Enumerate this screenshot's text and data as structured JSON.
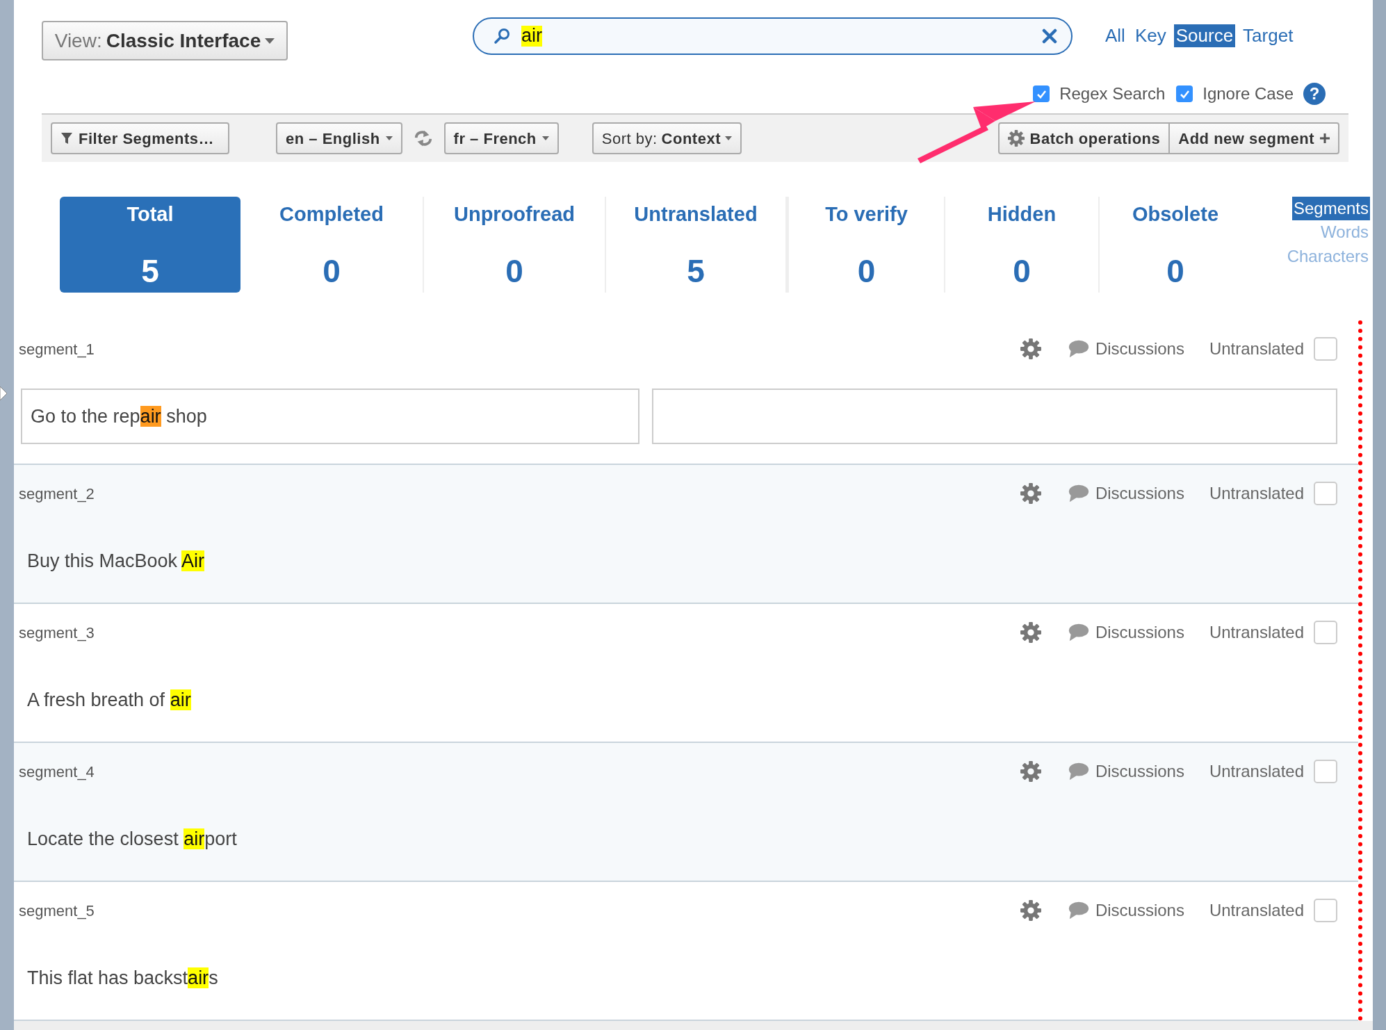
{
  "view_selector": {
    "label": "View:",
    "value": "Classic Interface"
  },
  "search": {
    "query": "air"
  },
  "search_scopes": [
    {
      "label": "All",
      "selected": false
    },
    {
      "label": "Key",
      "selected": false
    },
    {
      "label": "Source",
      "selected": true
    },
    {
      "label": "Target",
      "selected": false
    }
  ],
  "search_options": [
    {
      "label": "Regex Search",
      "checked": true
    },
    {
      "label": "Ignore Case",
      "checked": true
    }
  ],
  "help": {
    "label": "?"
  },
  "toolbar": {
    "filter": "Filter Segments…",
    "source_language": "en – English",
    "target_language": "fr – French",
    "sort_label": "Sort by:",
    "sort_value": "Context",
    "batch": "Batch operations",
    "add": "Add new segment"
  },
  "stats": [
    {
      "label": "Total",
      "value": "5",
      "selected": true
    },
    {
      "label": "Completed",
      "value": "0",
      "selected": false
    },
    {
      "label": "Unproofread",
      "value": "0",
      "selected": false
    },
    {
      "label": "Untranslated",
      "value": "5",
      "selected": false
    },
    {
      "label": "To verify",
      "value": "0",
      "selected": false
    },
    {
      "label": "Hidden",
      "value": "0",
      "selected": false
    },
    {
      "label": "Obsolete",
      "value": "0",
      "selected": false
    }
  ],
  "units": [
    {
      "label": "Segments",
      "selected": true
    },
    {
      "label": "Words",
      "selected": false
    },
    {
      "label": "Characters",
      "selected": false
    }
  ],
  "segments": [
    {
      "key": "segment_1",
      "discussions": "Discussions",
      "status": "Untranslated",
      "checked": false,
      "editing": true,
      "source": [
        {
          "text": "Go to the rep",
          "kind": "text"
        },
        {
          "text": "air",
          "kind": "current-match"
        },
        {
          "text": " shop",
          "kind": "text"
        }
      ]
    },
    {
      "key": "segment_2",
      "discussions": "Discussions",
      "status": "Untranslated",
      "checked": false,
      "editing": false,
      "source": [
        {
          "text": "Buy this MacBook ",
          "kind": "text"
        },
        {
          "text": "Air",
          "kind": "match"
        }
      ]
    },
    {
      "key": "segment_3",
      "discussions": "Discussions",
      "status": "Untranslated",
      "checked": false,
      "editing": false,
      "source": [
        {
          "text": "A fresh breath of ",
          "kind": "text"
        },
        {
          "text": "air",
          "kind": "match"
        }
      ]
    },
    {
      "key": "segment_4",
      "discussions": "Discussions",
      "status": "Untranslated",
      "checked": false,
      "editing": false,
      "source": [
        {
          "text": "Locate the closest ",
          "kind": "text"
        },
        {
          "text": "air",
          "kind": "match"
        },
        {
          "text": "port",
          "kind": "text"
        }
      ]
    },
    {
      "key": "segment_5",
      "discussions": "Discussions",
      "status": "Untranslated",
      "checked": false,
      "editing": false,
      "source": [
        {
          "text": "This flat has backst",
          "kind": "text"
        },
        {
          "text": "air",
          "kind": "match"
        },
        {
          "text": "s",
          "kind": "text"
        }
      ]
    }
  ]
}
